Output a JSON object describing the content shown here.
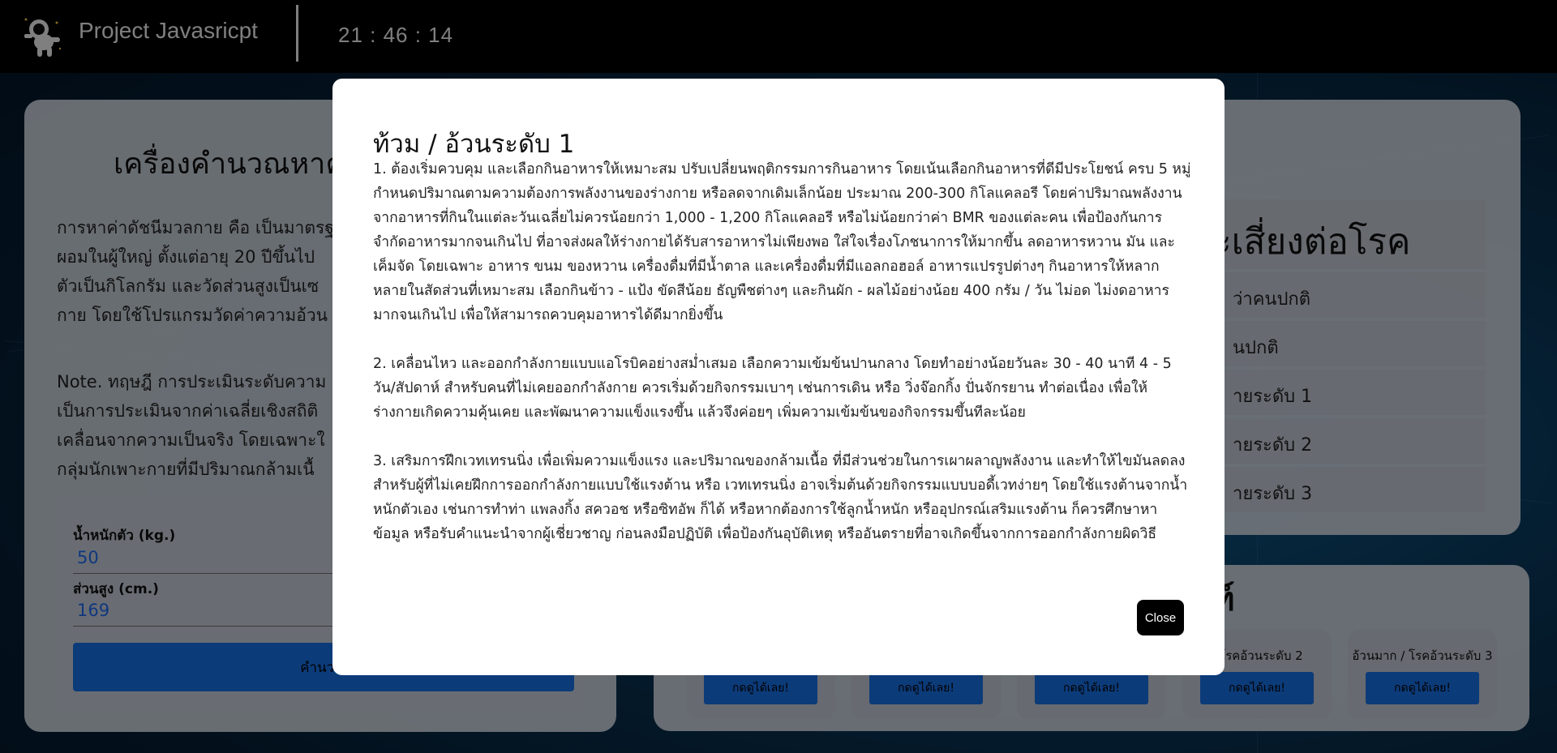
{
  "header": {
    "brand": "Project Javasricpt",
    "clock": "21 : 46 : 14"
  },
  "left_card": {
    "title": "เครื่องคำนวณหาค่",
    "intro_lines": [
      "การหาค่าดัชนีมวลกาย คือ เป็นมาตรฐ",
      "ผอมในผู้ใหญ่ ตั้งแต่อายุ 20 ปีขึ้นไป",
      "ตัวเป็นกิโลกรัม และวัดส่วนสูงเป็นเซ",
      "กาย โดยใช้โปรแกรมวัดค่าความอ้วน"
    ],
    "note_lines": [
      "Note. ทฤษฎี การประเมินระดับความ",
      "เป็นการประเมินจากค่าเฉลี่ยเชิงสถิติ",
      "เคลื่อนจากความเป็นจริง โดยเฉพาะใ",
      "กลุ่มนักเพาะกายที่มีปริมาณกล้ามเนื้"
    ],
    "weight_label": "น้ำหนักตัว (kg.)",
    "weight_value": "50",
    "height_label": "ส่วนสูง (cm.)",
    "height_value": "169",
    "calc_button": "คำนวณ"
  },
  "right_card": {
    "title": "ะเสี่ยงต่อโรค",
    "items": [
      "ว่าคนปกติ",
      "นปกติ",
      "ายระดับ 1",
      "ายระดับ 2",
      "ายระดับ 3"
    ]
  },
  "bottom_card": {
    "title": "ท์",
    "cards": [
      {
        "label": "",
        "button": "กดดูได้เลย!"
      },
      {
        "label": "",
        "button": "กดดูได้เลย!"
      },
      {
        "label": "",
        "button": "กดดูได้เลย!"
      },
      {
        "label": "/ โรคอ้วนระดับ 2",
        "button": "กดดูได้เลย!"
      },
      {
        "label": "อ้วนมาก / โรคอ้วนระดับ 3",
        "button": "กดดูได้เลย!"
      }
    ]
  },
  "modal": {
    "title": "ท้วม / อ้วนระดับ 1",
    "paragraphs": [
      "1. ต้องเริ่มควบคุม และเลือกกินอาหารให้เหมาะสม ปรับเปลี่ยนพฤติกรรมการกินอาหาร โดยเน้นเลือกกินอาหารที่ดีมีประโยชน์ ครบ 5 หมู่ กำหนดปริมาณตามความต้องการพลังงานของร่างกาย หรือลดจากเดิมเล็กน้อย ประมาณ 200-300 กิโลแคลอรี โดยค่าปริมาณพลังงานจากอาหารที่กินในแต่ละวันเฉลี่ยไม่ควรน้อยกว่า 1,000 - 1,200 กิโลแคลอรี หรือไม่น้อยกว่าค่า BMR ของแต่ละคน เพื่อป้องกันการจำกัดอาหารมากจนเกินไป ที่อาจส่งผลให้ร่างกายได้รับสารอาหารไม่เพียงพอ ใส่ใจเรื่องโภชนาการให้มากขึ้น ลดอาหารหวาน มัน และเค็มจัด โดยเฉพาะ อาหาร ขนม ของหวาน เครื่องดื่มที่มีน้ำตาล และเครื่องดื่มที่มีแอลกอฮอล์ อาหารแปรรูปต่างๆ กินอาหารให้หลากหลายในสัดส่วนที่เหมาะสม เลือกกินข้าว - แป้ง ขัดสีน้อย ธัญพืชต่างๆ และกินผัก - ผลไม้อย่างน้อย 400 กรัม / วัน ไม่อด ไม่งดอาหารมากจนเกินไป เพื่อให้สามารถควบคุมอาหารได้ดีมากยิ่งขึ้น",
      "2. เคลื่อนไหว และออกกำลังกายแบบแอโรบิคอย่างสม่ำเสมอ เลือกความเข้มข้นปานกลาง โดยทำอย่างน้อยวันละ 30 - 40 นาที 4 - 5 วัน/สัปดาห์ สำหรับคนที่ไม่เคยออกกำลังกาย ควรเริ่มด้วยกิจกรรมเบาๆ เช่นการเดิน หรือ วิ่งจ๊อกกิ้ง ปั่นจักรยาน ทำต่อเนื่อง เพื่อให้ร่างกายเกิดความคุ้นเคย และพัฒนาความแข็งแรงขึ้น แล้วจึงค่อยๆ เพิ่มความเข้มข้นของกิจกรรมขึ้นทีละน้อย",
      "3. เสริมการฝึกเวทเทรนนิ่ง เพื่อเพิ่มความแข็งแรง และปริมาณของกล้ามเนื้อ ที่มีส่วนช่วยในการเผาผลาญพลังงาน และทำให้ไขมันลดลง สำหรับผู้ที่ไม่เคยฝึกการออกกำลังกายแบบใช้แรงต้าน หรือ เวทเทรนนิ่ง อาจเริ่มต้นด้วยกิจกรรมแบบบอดี้เวทง่ายๆ โดยใช้แรงต้านจากน้ำหนักตัวเอง เช่นการทำท่า แพลงกิ้ง สควอช หรือซิทอัพ ก็ได้ หรือหากต้องการใช้ลูกน้ำหนัก หรืออุปกรณ์เสริมแรงต้าน ก็ควรศึกษาหาข้อมูล หรือรับคำแนะนำจากผู้เชี่ยวชาญ ก่อนลงมือปฏิบัติ เพื่อป้องกันอุบัติเหตุ หรืออันตรายที่อาจเกิดขึ้นจากการออกกำลังกายผิดวิธี"
    ],
    "close_button": "Close"
  }
}
